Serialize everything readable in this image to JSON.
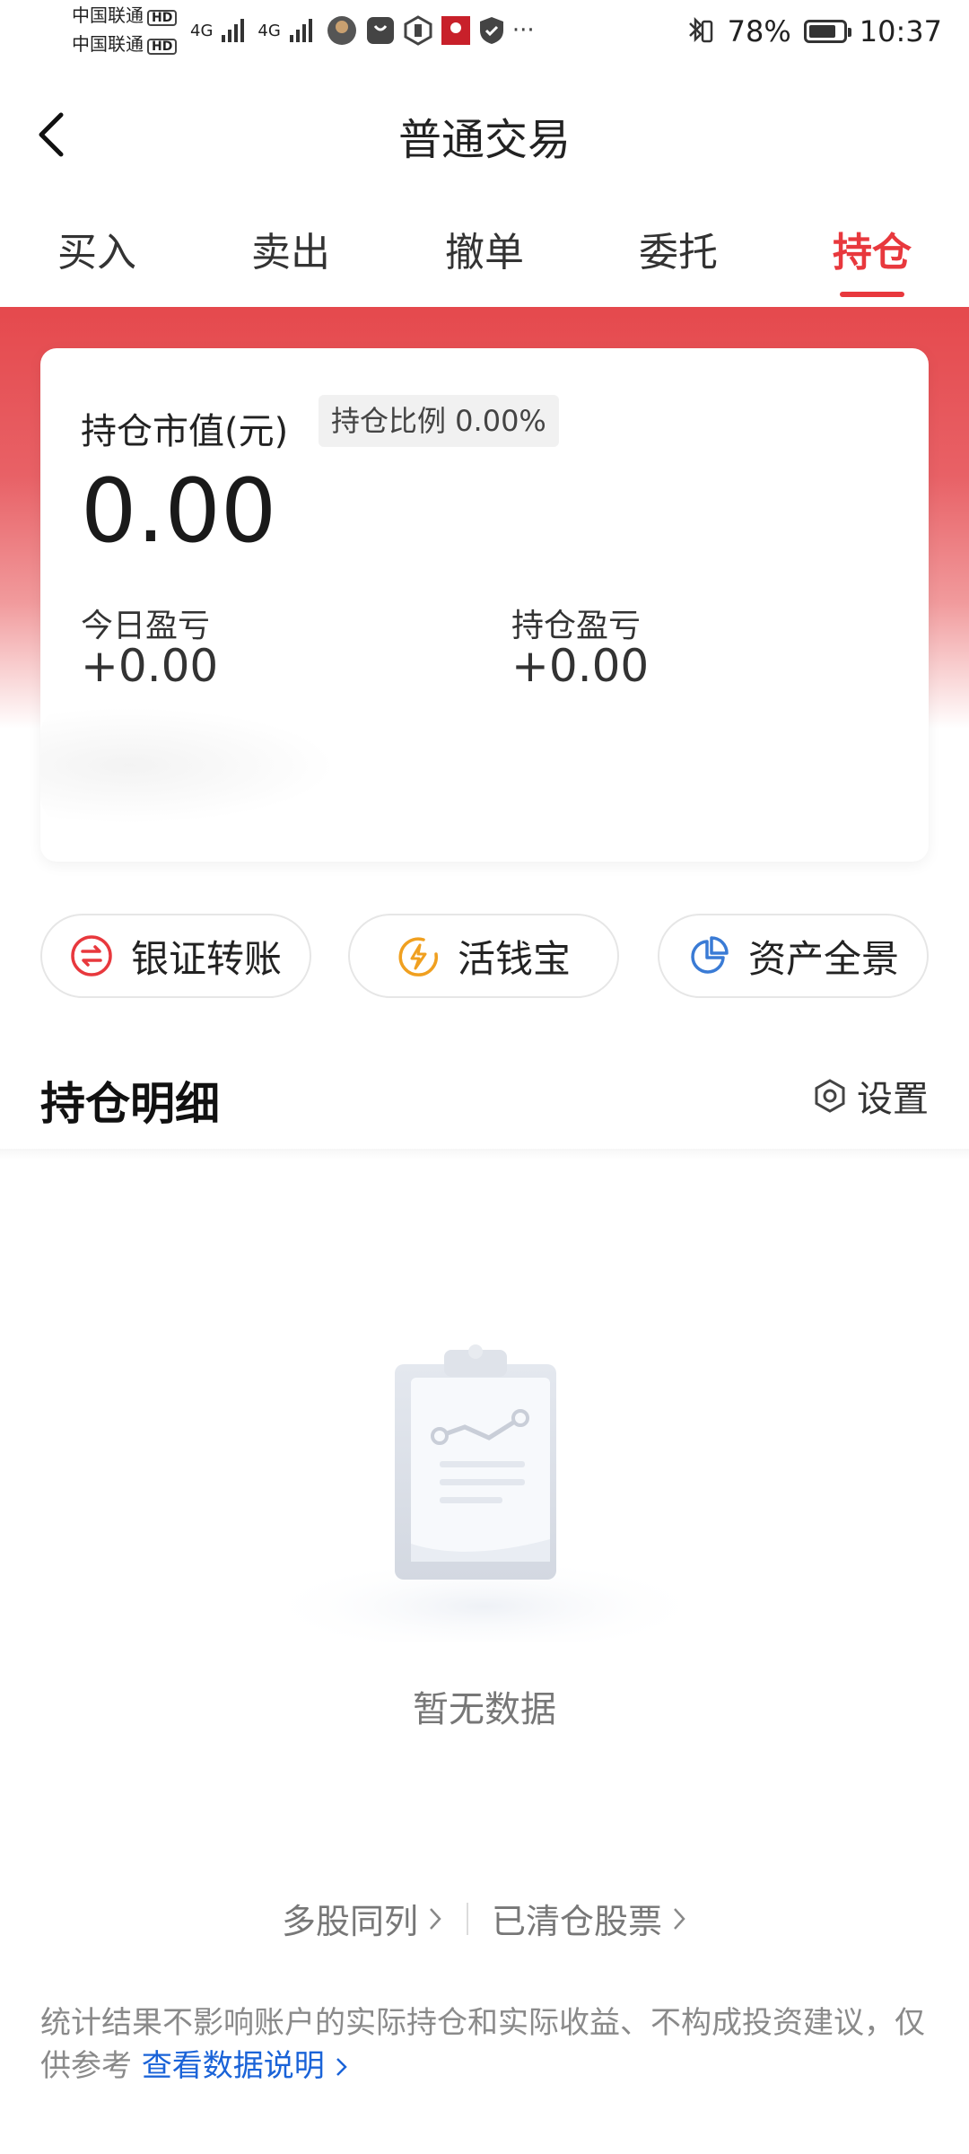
{
  "status_bar": {
    "carrier1": "中国联通",
    "carrier2": "中国联通",
    "hd": "HD",
    "network": "4G",
    "battery": "78%",
    "time": "10:37"
  },
  "header": {
    "title": "普通交易"
  },
  "tabs": [
    {
      "label": "买入"
    },
    {
      "label": "卖出"
    },
    {
      "label": "撤单"
    },
    {
      "label": "委托"
    },
    {
      "label": "持仓",
      "active": true
    }
  ],
  "summary": {
    "market_value_label": "持仓市值(元)",
    "ratio_label": "持仓比例 0.00%",
    "market_value": "0.00",
    "today_pl_label": "今日盈亏",
    "today_pl": "+0.00",
    "position_pl_label": "持仓盈亏",
    "position_pl": "+0.00"
  },
  "quick_actions": [
    {
      "label": "银证转账",
      "icon": "transfer-icon",
      "color": "#e8383d"
    },
    {
      "label": "活钱宝",
      "icon": "lightning-icon",
      "color": "#f0a020"
    },
    {
      "label": "资产全景",
      "icon": "pie-icon",
      "color": "#3a7bd5"
    }
  ],
  "holdings": {
    "title": "持仓明细",
    "settings_label": "设置",
    "empty_text": "暂无数据"
  },
  "links": {
    "multi_stock": "多股同列",
    "cleared_stocks": "已清仓股票"
  },
  "disclaimer": {
    "text": "统计结果不影响账户的实际持仓和实际收益、不构成投资建议，仅供参考",
    "link": "查看数据说明"
  },
  "colors": {
    "accent": "#e8383d",
    "link": "#1a63d8"
  }
}
